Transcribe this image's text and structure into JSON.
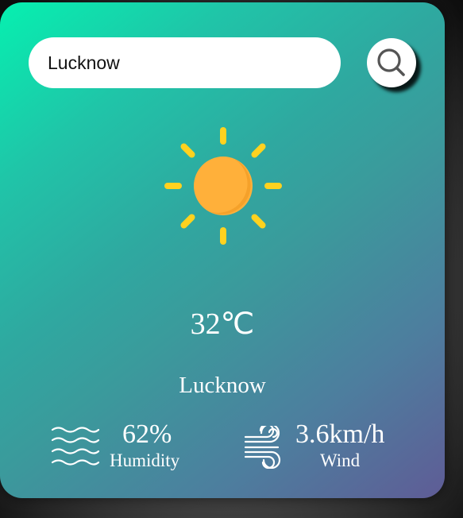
{
  "search": {
    "value": "Lucknow",
    "icon": "search-icon"
  },
  "weather": {
    "icon": "sun-icon",
    "temperature": "32℃",
    "city": "Lucknow"
  },
  "humidity": {
    "icon": "waves-icon",
    "value": "62%",
    "label": "Humidity"
  },
  "wind": {
    "icon": "wind-icon",
    "value": "3.6km/h",
    "label": "Wind"
  },
  "colors": {
    "gradient_start": "#06f0b0",
    "gradient_end": "#5f5c96",
    "sun_body": "#ffb03a",
    "sun_rays": "#ffd21f"
  }
}
